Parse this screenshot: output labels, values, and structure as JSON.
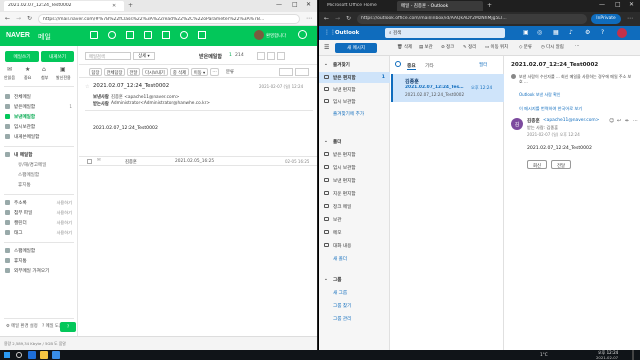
{
  "left": {
    "tab_title": "2021.02.07_12:24_Test0002",
    "url": "https://mail.naver.com/#%7B%22fClass%22%3A%22read%22%2C%22oParameter%22%3A%7B...",
    "brand": "NAVER",
    "brand_app": "메일",
    "user_label": "환영합니다",
    "write_button": "메일쓰기",
    "self_button": "내게쓰기",
    "quick": [
      "안읽음",
      "중요",
      "첨부",
      "발신전용"
    ],
    "nav": [
      {
        "label": "전체메일",
        "count": ""
      },
      {
        "label": "받은메일함",
        "count": "1"
      },
      {
        "label": "보낸메일함",
        "count": ""
      },
      {
        "label": "임시보관함",
        "count": ""
      },
      {
        "label": "내게쓴메일함",
        "count": ""
      }
    ],
    "nav2_header": "내 메일함",
    "nav2": [
      "유/해/경고메일",
      "스팸메일함",
      "휴지통"
    ],
    "nav3": [
      "주소록",
      "첨부 파일",
      "캘린더",
      "태그"
    ],
    "nav3_side": [
      "사용하기",
      "사용하기",
      "사용하기",
      "사용하기"
    ],
    "nav4": [
      "스팸메일함",
      "휴지통",
      "외부메일 가져오기"
    ],
    "bottom": [
      "메일 환경 설정",
      "메일 도움말"
    ],
    "folder_title": "받은메일함",
    "count_read": "1",
    "count_total": "214",
    "search_placeholder": "메일검색",
    "toolbar": [
      "답장",
      "전체답장",
      "전달",
      "다시보내기",
      "중 삭제",
      "이동 ▾",
      "⋯",
      "분류"
    ],
    "subject": "2021.02.07_12:24_Test0002",
    "date": "2021-02-07 (일) 12:24",
    "from_label": "보낸사람",
    "from_value": "김종훈 <apache11@naver.com>",
    "to_label": "받는사람",
    "to_value": "Administrator<Administrator@hanwhe.co.kr>",
    "body": "2021.02.07_12:24_Test0002",
    "mail_row_name": "김종훈",
    "mail_row_subject": "2021.02.05_16:25",
    "mail_row_date": "02-05 16:25",
    "status": "용량 2,589,34 Kbyte / 5GB    도 움말"
  },
  "right": {
    "tab_title": "메일 - 김종훈 - Outlook",
    "tab2_title": "Microsoft Office Home",
    "url": "https://outlook.office.com/mail/inbox/id/AAQkADY2MzNhMjg5LT...",
    "inprivate": "InPrivate",
    "app_name": "Outlook",
    "search": "검색",
    "new_message": "새 메시지",
    "toolbar": [
      "삭제",
      "보관",
      "정크",
      "정리",
      "이동 위치",
      "분류",
      "다시 알림",
      "⋯"
    ],
    "nav_header": "즐겨찾기",
    "nav_fav": [
      {
        "label": "받은 편지함",
        "count": "1"
      },
      {
        "label": "보낸 편지함",
        "count": ""
      },
      {
        "label": "임시 보관함",
        "count": ""
      },
      {
        "label": "즐겨찾기에 추가",
        "count": ""
      }
    ],
    "folders_header": "폴더",
    "folders": [
      "받은 편지함",
      "임시 보관함",
      "보낸 편지함",
      "지운 편지함",
      "정크 메일",
      "보관",
      "메모",
      "대화 내용",
      "새 폴더"
    ],
    "groups_header": "그룹",
    "groups": [
      "새 그룹",
      "그룹 찾기",
      "그룹 관리"
    ],
    "list_tabs": [
      "중요",
      "기타"
    ],
    "filter": "필터",
    "list_item": {
      "from": "김종훈",
      "subject": "2021.02.07_12:24_Test0002",
      "preview": "2021.02.07_12:24_Test0002",
      "time": "오후 12:24"
    },
    "read_subject": "2021.02.07_12:24_Test0002",
    "security_note": "보낸 사람이 수신자를 ... 회신 메일을 사용하는 경우에 메일 주소 보호 ...",
    "security_link": "Outlook 보낸 사람 확인",
    "translate": "이 메시지를 번역하여 한국어로 보기",
    "sender_name": "김종훈",
    "sender_email": "<apache11@naver.com>",
    "recipient": "받는 사람: 김종훈",
    "sent_time": "2021-02-07 (일) 오후 12:24",
    "read_body": "2021.02.07_12:24_Test0002",
    "reply": "회신",
    "forward": "전달"
  },
  "taskbar": {
    "time": "오후 12:24",
    "date": "2021-02-07",
    "weather": "1°C"
  }
}
